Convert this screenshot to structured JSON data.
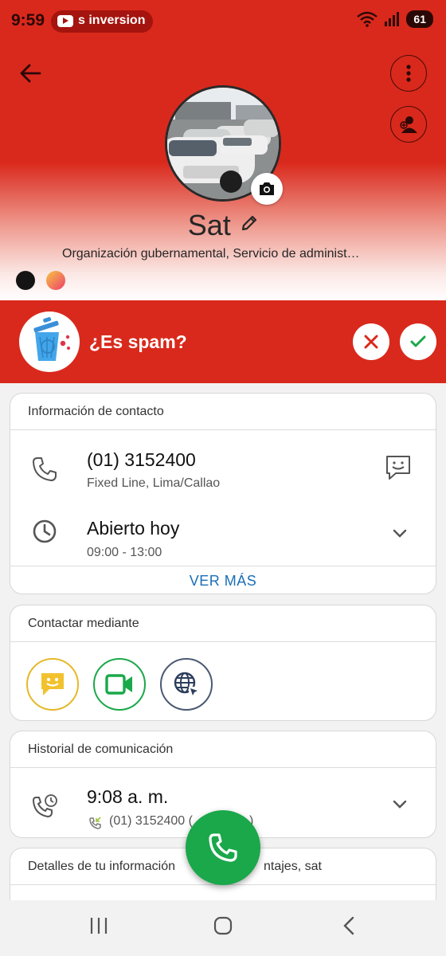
{
  "status_bar": {
    "time": "9:59",
    "media_text": "s inversion",
    "battery": "61"
  },
  "contact": {
    "name": "Sat",
    "subtitle": "Organización gubernamental, Servicio de administ…",
    "theme_colors": [
      "#141414",
      "#f0a43c"
    ]
  },
  "spam_prompt": {
    "question": "¿Es spam?"
  },
  "contact_info": {
    "title": "Información de contacto",
    "phone": "(01) 3152400",
    "phone_type": "Fixed Line, Lima/Callao",
    "hours_status": "Abierto hoy",
    "hours": "09:00 - 13:00",
    "see_more": "VER MÁS"
  },
  "contact_via": {
    "title": "Contactar mediante",
    "options": [
      "message-icon",
      "video-call-icon",
      "web-icon"
    ]
  },
  "history": {
    "title": "Historial de comunicación",
    "time": "9:08 a. m.",
    "number": "(01) 3152400 (",
    "number_tail": ")"
  },
  "details": {
    "title": "Detalles de tu información",
    "title_tail": "ntajes, sat"
  },
  "colors": {
    "brand_red": "#d9291c",
    "accent_green": "#1aa84a",
    "link_blue": "#1a6fb8"
  }
}
